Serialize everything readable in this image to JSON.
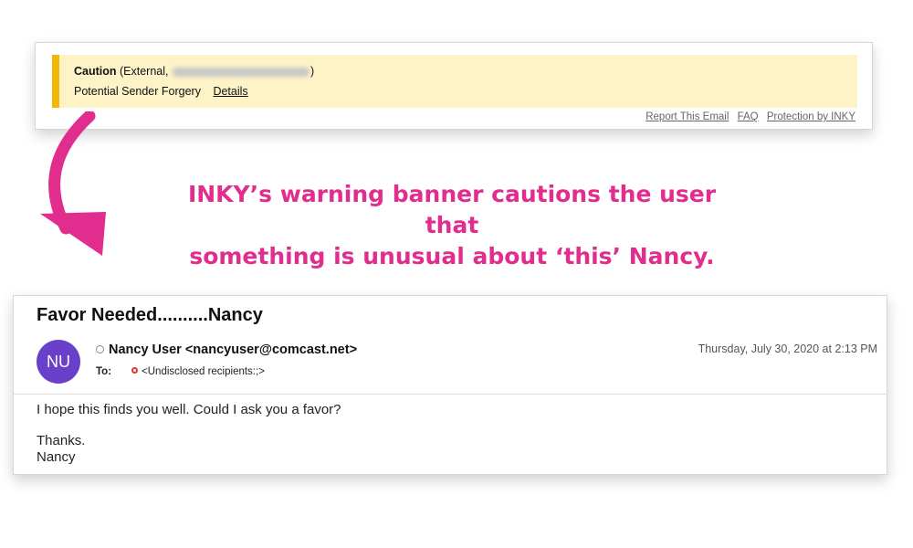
{
  "banner": {
    "caution_label": "Caution",
    "external_prefix": " (External, ",
    "external_suffix": ")",
    "forgery_text": "Potential Sender Forgery",
    "details_link": "Details",
    "links": [
      "Report This Email",
      "FAQ",
      "Protection by INKY"
    ],
    "accent_color": "#f2b705",
    "background_color": "#fdf3c7"
  },
  "callout": {
    "line1": "INKY’s warning banner cautions the user that",
    "line2": "something is unusual about ‘this’ Nancy.",
    "color": "#e02d8e",
    "icon": "curved-arrow-icon"
  },
  "email": {
    "subject": "Favor Needed..........Nancy",
    "avatar_initials": "NU",
    "avatar_color": "#6a3fc9",
    "sender": "Nancy User <nancyuser@comcast.net>",
    "to_label": "To:",
    "recipients": "<Undisclosed recipients:;>",
    "date": "Thursday, July 30, 2020 at 2:13 PM",
    "body_line1": "I hope this finds you well. Could I ask you a favor?",
    "signoff": "Thanks.",
    "signature": "Nancy"
  }
}
